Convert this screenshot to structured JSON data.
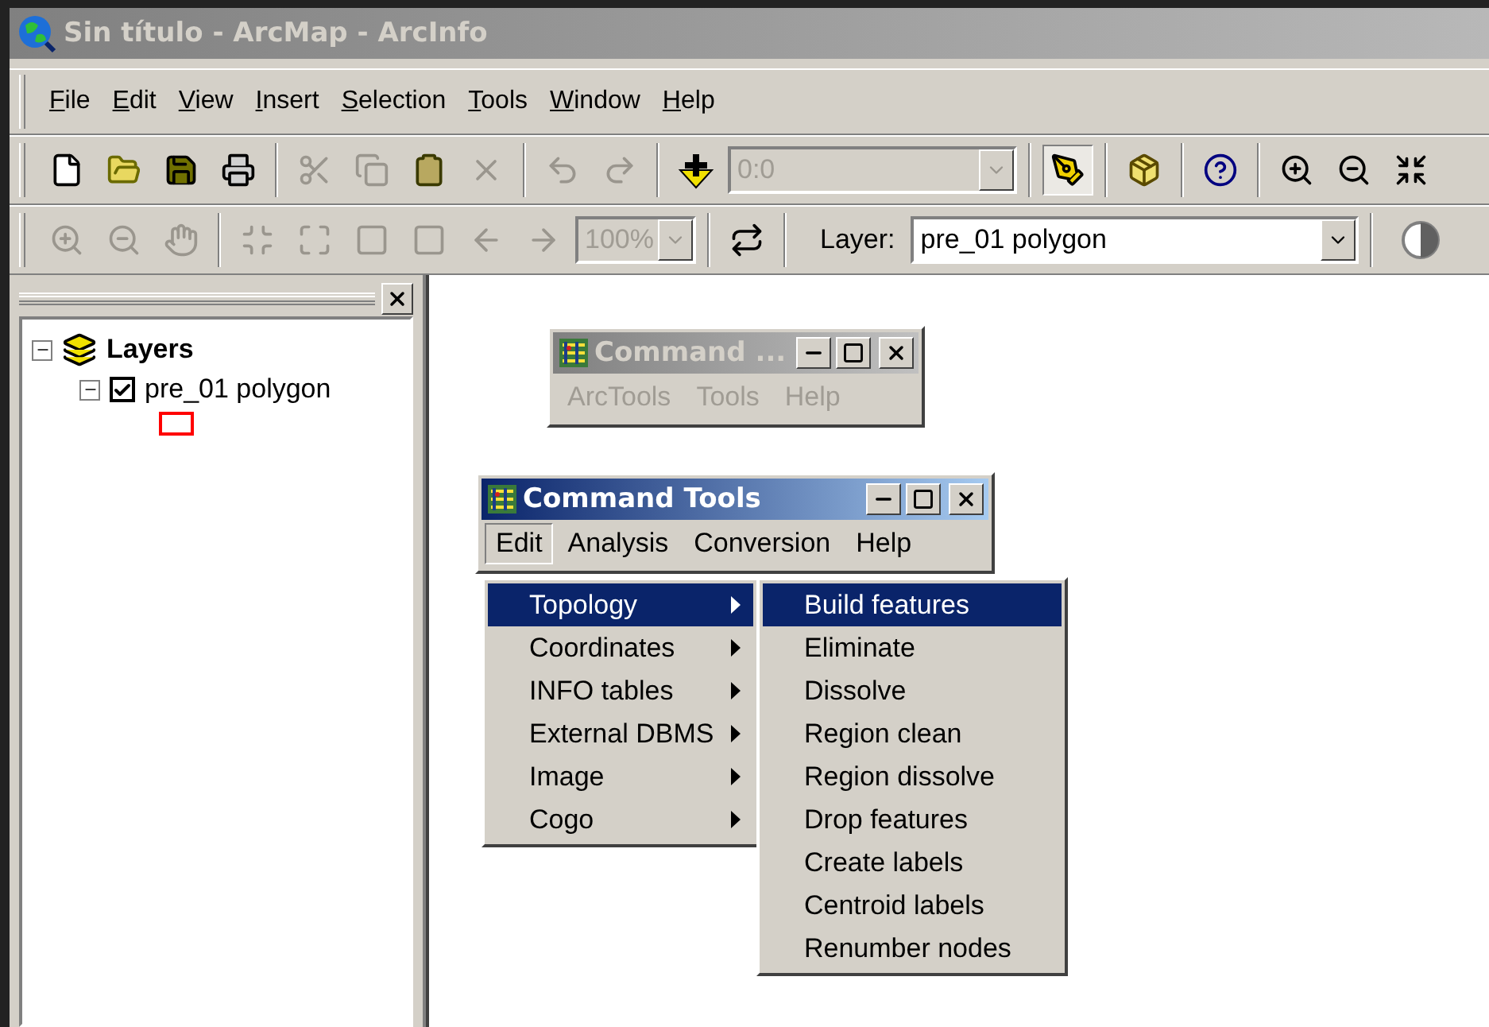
{
  "window": {
    "title": "Sin título - ArcMap - ArcInfo"
  },
  "menu": [
    "File",
    "Edit",
    "View",
    "Insert",
    "Selection",
    "Tools",
    "Window",
    "Help"
  ],
  "standard_toolbar": {
    "scale": "0:0"
  },
  "tools_toolbar": {
    "zoom": "100%",
    "layer_label": "Layer:",
    "layer_value": "pre_01 polygon"
  },
  "table_of_contents": {
    "label": "Layers",
    "expanded": true,
    "children": [
      {
        "label": "pre_01 polygon",
        "checked": true,
        "expanded": true
      }
    ]
  },
  "command_windows": [
    {
      "title": "Command ...",
      "active": false,
      "menu": [
        {
          "label": "ArcTools",
          "selected": false
        },
        {
          "label": "Tools",
          "selected": false
        },
        {
          "label": "Help",
          "selected": false
        }
      ]
    },
    {
      "title": "Command Tools",
      "active": true,
      "menu": [
        {
          "label": "Edit",
          "selected": true
        },
        {
          "label": "Analysis",
          "selected": false
        },
        {
          "label": "Conversion",
          "selected": false
        },
        {
          "label": "Help",
          "selected": false
        }
      ]
    }
  ],
  "edit_menu": [
    {
      "label": "Topology",
      "selected": true
    },
    {
      "label": "Coordinates",
      "selected": false
    },
    {
      "label": "INFO tables",
      "selected": false
    },
    {
      "label": "External DBMS",
      "selected": false
    },
    {
      "label": "Image",
      "selected": false
    },
    {
      "label": "Cogo",
      "selected": false
    }
  ],
  "topology_submenu": [
    {
      "label": "Build features",
      "selected": true
    },
    {
      "label": "Eliminate",
      "selected": false
    },
    {
      "label": "Dissolve",
      "selected": false
    },
    {
      "label": "Region clean",
      "selected": false
    },
    {
      "label": "Region dissolve",
      "selected": false
    },
    {
      "label": "Drop features",
      "selected": false
    },
    {
      "label": "Create labels",
      "selected": false
    },
    {
      "label": "Centroid labels",
      "selected": false
    },
    {
      "label": "Renumber nodes",
      "selected": false
    }
  ]
}
